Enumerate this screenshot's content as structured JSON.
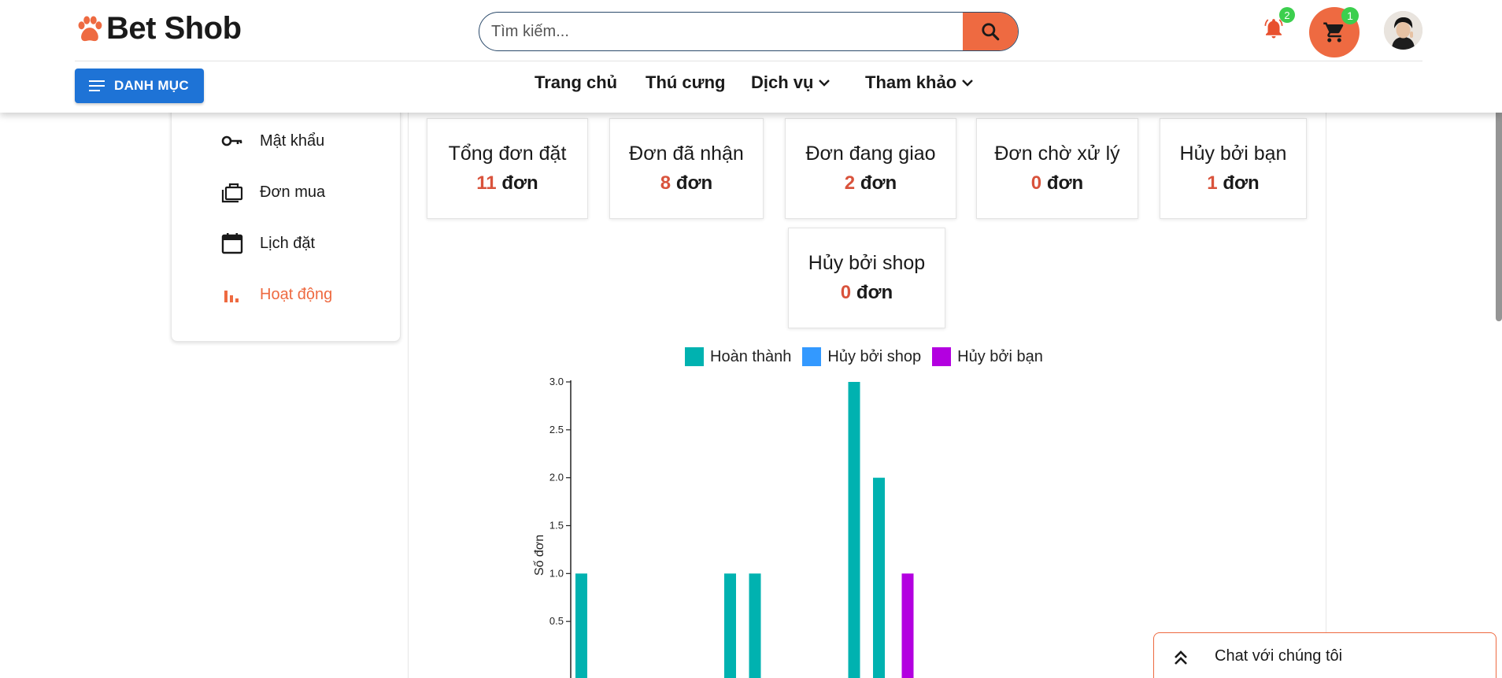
{
  "header": {
    "brand": "Bet Shob",
    "search_placeholder": "Tìm kiếm...",
    "notification_count": "2",
    "cart_count": "1",
    "menu_button_label": "DANH MỤC",
    "nav": [
      {
        "label": "Trang chủ",
        "has_dropdown": false
      },
      {
        "label": "Thú cưng",
        "has_dropdown": false
      },
      {
        "label": "Dịch vụ",
        "has_dropdown": true
      },
      {
        "label": "Tham khảo",
        "has_dropdown": true
      }
    ],
    "colors": {
      "accent": "#ee6a41",
      "primary": "#1e73d6",
      "badge": "#3ccf4e"
    }
  },
  "sidebar": {
    "items": [
      {
        "label": "Mật khẩu",
        "icon": "key-icon",
        "active": false
      },
      {
        "label": "Đơn mua",
        "icon": "briefcase-icon",
        "active": false
      },
      {
        "label": "Lịch đặt",
        "icon": "calendar-icon",
        "active": false
      },
      {
        "label": "Hoạt động",
        "icon": "bar-chart-icon",
        "active": true
      }
    ]
  },
  "stats": {
    "unit": "đơn",
    "cards": [
      {
        "title": "Tổng đơn đặt",
        "value": "11"
      },
      {
        "title": "Đơn đã nhận",
        "value": "8"
      },
      {
        "title": "Đơn đang giao",
        "value": "2"
      },
      {
        "title": "Đơn chờ xử lý",
        "value": "0"
      },
      {
        "title": "Hủy bởi bạn",
        "value": "1"
      },
      {
        "title": "Hủy bởi shop",
        "value": "0"
      }
    ]
  },
  "chart_data": {
    "type": "bar",
    "ylabel": "Số đơn",
    "ylim": [
      0,
      3
    ],
    "yticks": [
      "3.0",
      "2.5",
      "2.0",
      "1.5",
      "1.0",
      "0.5"
    ],
    "legend_position": "top",
    "series": [
      {
        "name": "Hoàn thành",
        "color": "#00b2b0",
        "values": [
          1,
          0,
          0,
          0,
          0,
          0,
          1,
          1,
          0,
          0,
          0,
          3,
          2
        ]
      },
      {
        "name": "Hủy bởi shop",
        "color": "#3399ff",
        "values": [
          0,
          0,
          0,
          0,
          0,
          0,
          0,
          0,
          0,
          0,
          0,
          0,
          0
        ]
      },
      {
        "name": "Hủy bởi bạn",
        "color": "#b300e0",
        "values": [
          0,
          0,
          0,
          0,
          0,
          0,
          0,
          0,
          0,
          0,
          0,
          1,
          0
        ]
      }
    ]
  },
  "chat": {
    "label": "Chat với chúng tôi"
  }
}
